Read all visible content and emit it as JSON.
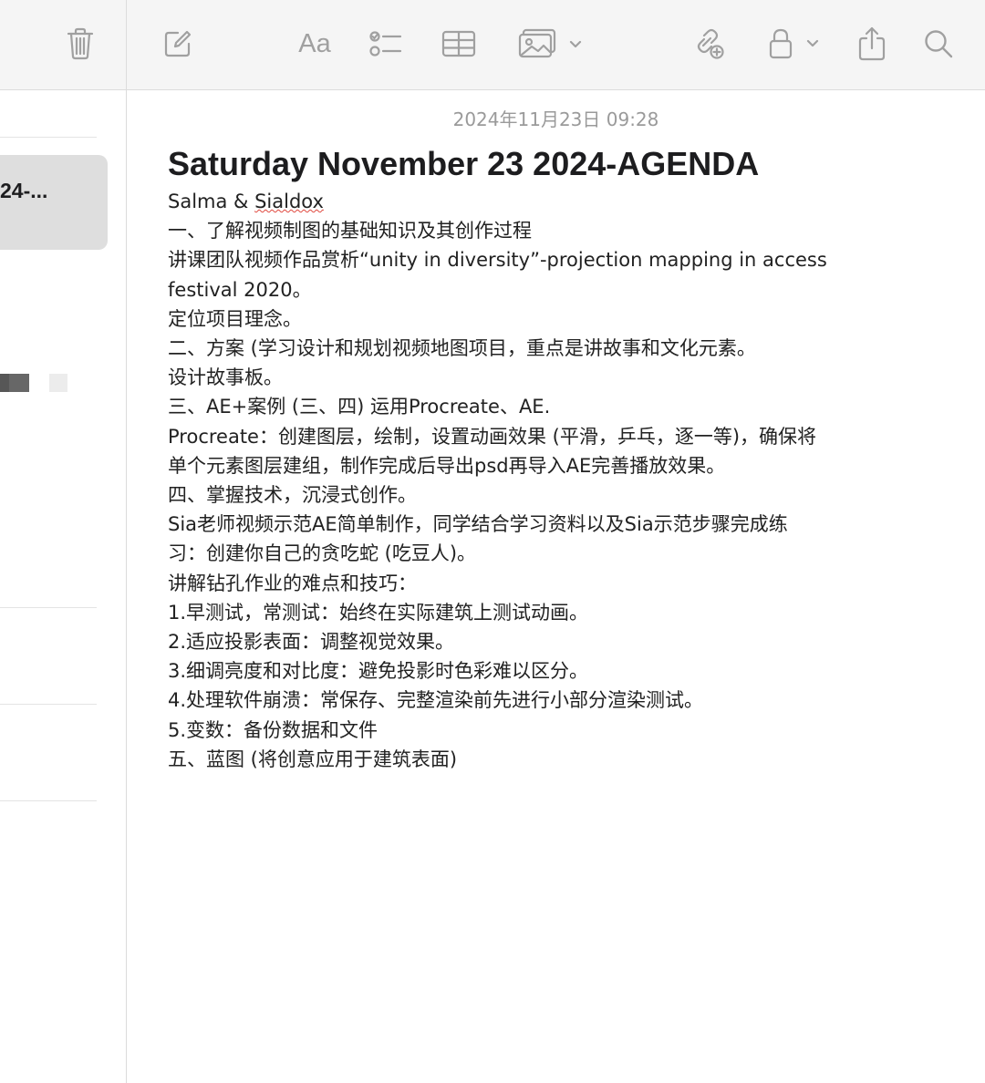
{
  "list_pane": {
    "selected_note_title": "24-..."
  },
  "toolbar": {
    "icons": [
      "trash-icon",
      "compose-icon",
      "format-icon",
      "checklist-icon",
      "table-icon",
      "media-icon",
      "share-collab-icon",
      "lock-icon",
      "share-icon",
      "search-icon"
    ],
    "format_label": "Aa"
  },
  "note": {
    "timestamp": "2024年11月23日 09:28",
    "title": "Saturday November 23 2024-AGENDA",
    "authors_prefix": "Salma & ",
    "authors_name": "Sialdox",
    "lines": [
      "一、了解视频制图的基础知识及其创作过程",
      "讲课团队视频作品赏析“unity in diversity”-projection mapping in access",
      "festival 2020。",
      "定位项目理念。",
      "二、方案 (学习设计和规划视频地图项目，重点是讲故事和文化元素。",
      "设计故事板。",
      "三、AE+案例 (三、四) 运用Procreate、AE.",
      "Procreate：创建图层，绘制，设置动画效果 (平滑，乒乓，逐一等)，确保将",
      "单个元素图层建组，制作完成后导出psd再导入AE完善播放效果。",
      "四、掌握技术，沉浸式创作。",
      "Sia老师视频示范AE简单制作，同学结合学习资料以及Sia示范步骤完成练",
      "习：创建你自己的贪吃蛇 (吃豆人)。",
      "讲解钻孔作业的难点和技巧：",
      "1.早测试，常测试：始终在实际建筑上测试动画。",
      "2.适应投影表面：调整视觉效果。",
      "3.细调亮度和对比度：避免投影时色彩难以区分。",
      "4.处理软件崩溃：常保存、完整渲染前先进行小部分渲染测试。",
      "5.变数：备份数据和文件",
      "五、蓝图 (将创意应用于建筑表面)"
    ]
  },
  "colors": {
    "toolbar_bg": "#f5f5f5",
    "icon_gray": "#a0a0a0",
    "selected_card": "#dedede",
    "timestamp_gray": "#9a9a9a",
    "spellcheck_red": "#e0483e"
  }
}
